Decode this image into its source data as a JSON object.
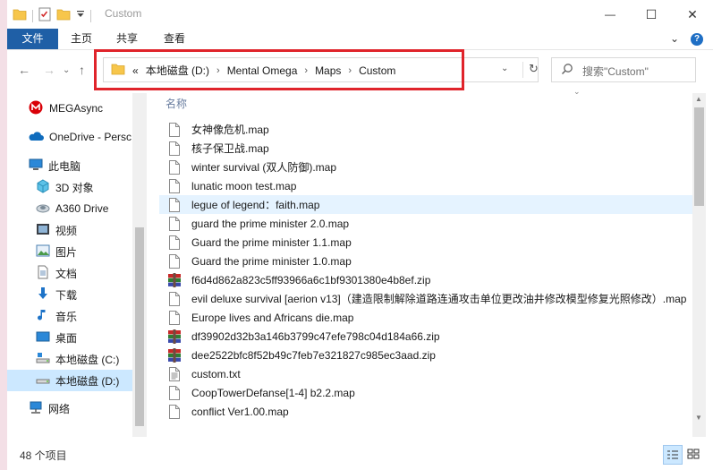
{
  "window": {
    "title": "Custom",
    "minimize_glyph": "—",
    "maximize_glyph": "☐",
    "close_glyph": "✕"
  },
  "ribbon": {
    "tabs": [
      "文件",
      "主页",
      "共享",
      "查看"
    ],
    "collapse_glyph": "⌄",
    "help_glyph": "?"
  },
  "nav": {
    "back_glyph": "←",
    "forward_glyph": "→",
    "recent_glyph": "⌄",
    "up_glyph": "↑"
  },
  "address": {
    "overflow": "«",
    "crumbs": [
      "本地磁盘 (D:)",
      "Mental Omega",
      "Maps",
      "Custom"
    ],
    "separator": "›",
    "dropdown_glyph": "⌄",
    "refresh_glyph": "↻"
  },
  "search": {
    "placeholder": "搜索\"Custom\""
  },
  "sidebar": {
    "items": [
      {
        "label": "MEGAsync",
        "icon": "megasync-icon"
      },
      {
        "label": "OneDrive - Persc",
        "icon": "onedrive-icon"
      },
      {
        "label": "此电脑",
        "icon": "this-pc-icon"
      },
      {
        "label": "3D 对象",
        "icon": "3d-objects-icon"
      },
      {
        "label": "A360 Drive",
        "icon": "a360-drive-icon"
      },
      {
        "label": "视频",
        "icon": "videos-icon"
      },
      {
        "label": "图片",
        "icon": "pictures-icon"
      },
      {
        "label": "文档",
        "icon": "documents-icon"
      },
      {
        "label": "下载",
        "icon": "downloads-icon"
      },
      {
        "label": "音乐",
        "icon": "music-icon"
      },
      {
        "label": "桌面",
        "icon": "desktop-icon"
      },
      {
        "label": "本地磁盘 (C:)",
        "icon": "drive-c-icon"
      },
      {
        "label": "本地磁盘 (D:)",
        "icon": "drive-d-icon"
      },
      {
        "label": "网络",
        "icon": "network-icon"
      }
    ]
  },
  "filelist": {
    "column_name": "名称",
    "files": [
      {
        "name": "女神像危机.map",
        "type": "file"
      },
      {
        "name": "核子保卫战.map",
        "type": "file"
      },
      {
        "name": "winter survival (双人防御).map",
        "type": "file"
      },
      {
        "name": "lunatic moon test.map",
        "type": "file"
      },
      {
        "name": "legue of legend：faith.map",
        "type": "file"
      },
      {
        "name": "guard the prime minister 2.0.map",
        "type": "file"
      },
      {
        "name": "Guard the prime minister 1.1.map",
        "type": "file"
      },
      {
        "name": "Guard the prime minister 1.0.map",
        "type": "file"
      },
      {
        "name": "f6d4d862a823c5ff93966a6c1bf9301380e4b8ef.zip",
        "type": "zip"
      },
      {
        "name": "evil deluxe survival [aerion v13]（建造限制解除道路连通攻击单位更改油井修改模型修复光照修改）.map",
        "type": "file"
      },
      {
        "name": "Europe lives and Africans die.map",
        "type": "file"
      },
      {
        "name": "df39902d32b3a146b3799c47efe798c04d184a66.zip",
        "type": "zip"
      },
      {
        "name": "dee2522bfc8f52b49c7feb7e321827c985ec3aad.zip",
        "type": "zip"
      },
      {
        "name": "custom.txt",
        "type": "txt"
      },
      {
        "name": "CoopTowerDefanse[1-4] b2.2.map",
        "type": "file"
      },
      {
        "name": "conflict Ver1.00.map",
        "type": "file"
      }
    ]
  },
  "status": {
    "item_count": "48 个项目"
  },
  "colors": {
    "accent": "#1f5fa6",
    "highlight_border": "#e0242b",
    "hover_row": "#e5f3ff",
    "selected_sidebar": "#cce8ff"
  }
}
